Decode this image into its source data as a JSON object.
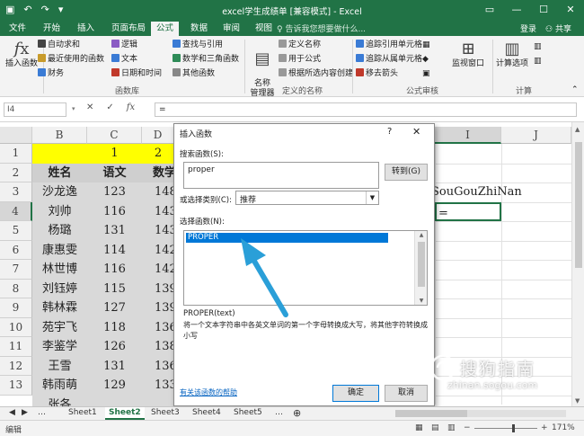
{
  "window": {
    "title": "excel学生成绩单 [兼容模式] - Excel",
    "login": "登录",
    "share": "共享",
    "tell_me": "♀ 告诉我您想要做什么..."
  },
  "tabs": [
    "文件",
    "开始",
    "插入",
    "页面布局",
    "公式",
    "数据",
    "审阅",
    "视图"
  ],
  "active_tab": "公式",
  "ribbon": {
    "insert_function": "插入函数",
    "lib_items": [
      {
        "label": "自动求和",
        "color": "#333333"
      },
      {
        "label": "最近使用的函数",
        "color": "#c89b2b"
      },
      {
        "label": "财务",
        "color": "#3a7bd5"
      },
      {
        "label": "逻辑",
        "color": "#8b5cc4"
      },
      {
        "label": "文本",
        "color": "#3a7bd5"
      },
      {
        "label": "日期和时间",
        "color": "#c0392b"
      },
      {
        "label": "查找与引用",
        "color": "#3a7bd5"
      },
      {
        "label": "数学和三角函数",
        "color": "#2e8b57"
      },
      {
        "label": "其他函数",
        "color": "#888888"
      }
    ],
    "name_manager": "名称\n管理器",
    "name_items": [
      "定义名称",
      "用于公式",
      "根据所选内容创建"
    ],
    "audit_items": [
      "追踪引用单元格",
      "追踪从属单元格",
      "移去箭头"
    ],
    "watch_window": "监视窗口",
    "calc_options": "计算选项",
    "groups": {
      "library": "函数库",
      "names": "定义的名称",
      "audit": "公式审核",
      "calc": "计算"
    }
  },
  "formula_bar": {
    "name_box": "I4",
    "cancel": "✕",
    "enter": "✓",
    "fx": "fx",
    "value": "="
  },
  "columns": [
    "B",
    "C",
    "D",
    "I",
    "J"
  ],
  "rows": [
    "1",
    "2",
    "3",
    "4",
    "5",
    "6",
    "7",
    "8",
    "9",
    "10",
    "11",
    "12",
    "13"
  ],
  "cells": {
    "c1": "1",
    "d1": "2",
    "headers": [
      "姓名",
      "语文",
      "数学"
    ],
    "names": [
      "沙龙逸",
      "刘帅",
      "杨璐",
      "康惠雯",
      "林世博",
      "刘钰婷",
      "韩林霖",
      "苑宇飞",
      "李鉴学",
      "王雪",
      "韩雨萌",
      "张各"
    ],
    "chinese": [
      "123",
      "116",
      "131",
      "114",
      "116",
      "115",
      "127",
      "118",
      "126",
      "131",
      "129",
      ""
    ],
    "math": [
      "148",
      "143",
      "143",
      "142",
      "142",
      "139",
      "139",
      "136",
      "138",
      "136",
      "133",
      ""
    ],
    "i3": "SouGouZhiNan",
    "i4": "="
  },
  "dialog": {
    "title": "插入函数",
    "help": "?",
    "close": "✕",
    "search_label": "搜索函数(S):",
    "search_value": "proper",
    "goto_button": "转到(G)",
    "category_label": "或选择类别(C):",
    "category_value": "推荐",
    "select_label": "选择函数(N):",
    "selected_function": "PROPER",
    "signature": "PROPER(text)",
    "description": "将一个文本字符串中各英文单词的第一个字母转换成大写，将其他字符转换成小写",
    "help_link": "有关该函数的帮助",
    "ok": "确定",
    "cancel": "取消"
  },
  "sheets": [
    "Sheet1",
    "Sheet2",
    "Sheet3",
    "Sheet4",
    "Sheet5"
  ],
  "active_sheet": "Sheet2",
  "status": {
    "mode": "编辑",
    "zoom": "171%"
  },
  "watermark": {
    "text": "搜狗指南",
    "sub": "zhinan.sogou.com"
  },
  "colors": {
    "excel_green": "#217346",
    "highlight_yellow": "#ffff00",
    "arrow_blue": "#2a9fd8",
    "selection_blue": "#0078d7"
  }
}
